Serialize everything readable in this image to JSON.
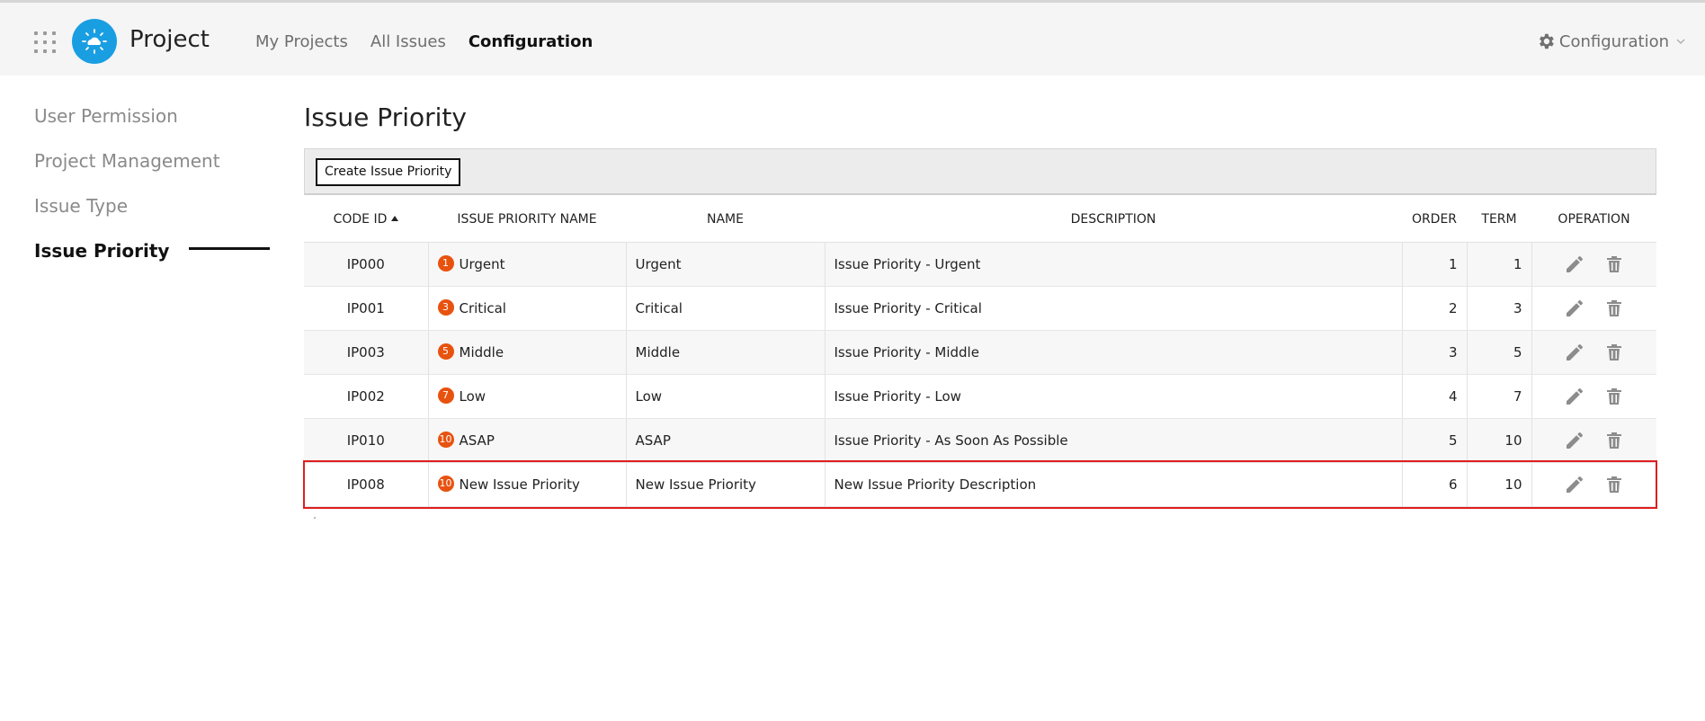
{
  "header": {
    "app_title": "Project",
    "nav": [
      {
        "label": "My Projects",
        "active": false
      },
      {
        "label": "All Issues",
        "active": false
      },
      {
        "label": "Configuration",
        "active": true
      }
    ],
    "config_menu_label": "Configuration",
    "logo_color": "#1a9ee2"
  },
  "sidebar": {
    "items": [
      {
        "label": "User Permission",
        "active": false
      },
      {
        "label": "Project Management",
        "active": false
      },
      {
        "label": "Issue Type",
        "active": false
      },
      {
        "label": "Issue Priority",
        "active": true
      }
    ]
  },
  "main": {
    "title": "Issue Priority",
    "create_button_label": "Create Issue Priority",
    "columns": [
      "CODE ID",
      "ISSUE PRIORITY NAME",
      "NAME",
      "DESCRIPTION",
      "ORDER",
      "TERM",
      "OPERATION"
    ],
    "sort": {
      "column": "CODE ID",
      "direction": "ascending"
    },
    "badge_color": "#e8520f",
    "highlight_color": "#e01e1e",
    "rows": [
      {
        "code_id": "IP000",
        "badge": "1",
        "priority_name": "Urgent",
        "name": "Urgent",
        "description": "Issue Priority - Urgent",
        "order": "1",
        "term": "1"
      },
      {
        "code_id": "IP001",
        "badge": "3",
        "priority_name": "Critical",
        "name": "Critical",
        "description": "Issue Priority - Critical",
        "order": "2",
        "term": "3"
      },
      {
        "code_id": "IP003",
        "badge": "5",
        "priority_name": "Middle",
        "name": "Middle",
        "description": "Issue Priority - Middle",
        "order": "3",
        "term": "5"
      },
      {
        "code_id": "IP002",
        "badge": "7",
        "priority_name": "Low",
        "name": "Low",
        "description": "Issue Priority - Low",
        "order": "4",
        "term": "7"
      },
      {
        "code_id": "IP010",
        "badge": "10",
        "priority_name": "ASAP",
        "name": "ASAP",
        "description": "Issue Priority - As Soon As Possible",
        "order": "5",
        "term": "10"
      },
      {
        "code_id": "IP008",
        "badge": "10",
        "priority_name": "New Issue Priority",
        "name": "New Issue Priority",
        "description": "New Issue Priority Description",
        "order": "6",
        "term": "10",
        "highlighted": true
      }
    ],
    "operation_icons": [
      "edit-icon",
      "trash-icon"
    ]
  }
}
